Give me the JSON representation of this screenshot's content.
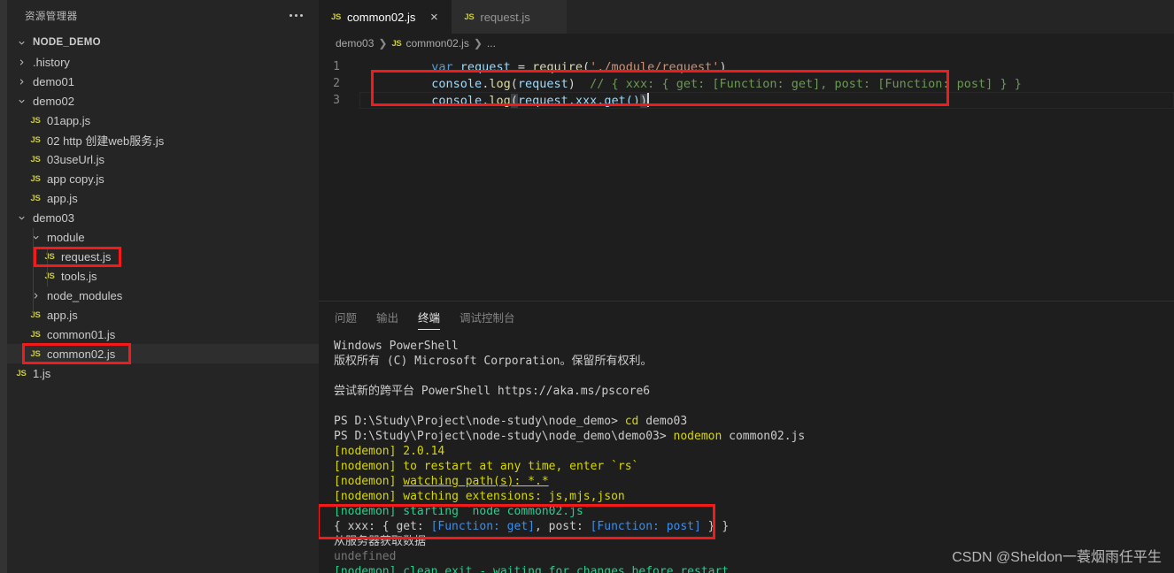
{
  "sidebar": {
    "title": "资源管理器",
    "more_icon": "ellipsis-icon",
    "root": "NODE_DEMO",
    "items": [
      {
        "label": ".history",
        "kind": "folder",
        "state": "collapsed",
        "depth": 1
      },
      {
        "label": "demo01",
        "kind": "folder",
        "state": "collapsed",
        "depth": 1
      },
      {
        "label": "demo02",
        "kind": "folder",
        "state": "expanded",
        "depth": 1
      },
      {
        "label": "01app.js",
        "kind": "file",
        "state": "",
        "depth": 2
      },
      {
        "label": "02 http 创建web服务.js",
        "kind": "file",
        "state": "",
        "depth": 2
      },
      {
        "label": "03useUrl.js",
        "kind": "file",
        "state": "",
        "depth": 2
      },
      {
        "label": "app copy.js",
        "kind": "file",
        "state": "",
        "depth": 2
      },
      {
        "label": "app.js",
        "kind": "file",
        "state": "",
        "depth": 2
      },
      {
        "label": "demo03",
        "kind": "folder",
        "state": "expanded",
        "depth": 1
      },
      {
        "label": "module",
        "kind": "folder",
        "state": "expanded",
        "depth": 2
      },
      {
        "label": "request.js",
        "kind": "file",
        "state": "",
        "depth": 3,
        "highlight": true
      },
      {
        "label": "tools.js",
        "kind": "file",
        "state": "",
        "depth": 3
      },
      {
        "label": "node_modules",
        "kind": "folder",
        "state": "collapsed",
        "depth": 2
      },
      {
        "label": "app.js",
        "kind": "file",
        "state": "",
        "depth": 2
      },
      {
        "label": "common01.js",
        "kind": "file",
        "state": "",
        "depth": 2
      },
      {
        "label": "common02.js",
        "kind": "file",
        "state": "",
        "depth": 2,
        "selected": true,
        "highlight": true
      },
      {
        "label": "1.js",
        "kind": "file",
        "state": "",
        "depth": 1
      }
    ]
  },
  "editor": {
    "tabs": [
      {
        "label": "common02.js",
        "active": true,
        "close_icon": "×"
      },
      {
        "label": "request.js",
        "active": false,
        "close_icon": "×"
      }
    ],
    "breadcrumb": [
      "demo03",
      "common02.js",
      "..."
    ],
    "lines": [
      {
        "no": "1"
      },
      {
        "no": "2"
      },
      {
        "no": "3"
      }
    ],
    "code": {
      "l1_kw": "var",
      "l1_var": " request ",
      "l1_op": "= ",
      "l1_fn": "require",
      "l1_paren_open": "(",
      "l1_str": "'./module/request'",
      "l1_paren_close": ")",
      "l2_obj": "console",
      "l2_dot": ".",
      "l2_fn": "log",
      "l2_open": "(",
      "l2_arg": "request",
      "l2_close": ")",
      "l2_comment": "  // { xxx: { get: [Function: get], post: [Function: post] } }",
      "l3_obj": "console",
      "l3_dot": ".",
      "l3_fn": "log",
      "l3_open": "(",
      "l3_arg": "request.xxx.get()",
      "l3_close": ")"
    }
  },
  "panel": {
    "tabs": [
      {
        "label": "问题",
        "active": false
      },
      {
        "label": "输出",
        "active": false
      },
      {
        "label": "终端",
        "active": true
      },
      {
        "label": "调试控制台",
        "active": false
      }
    ],
    "terminal": [
      {
        "text": "Windows PowerShell",
        "color": "t-white"
      },
      {
        "text": "版权所有 (C) Microsoft Corporation。保留所有权利。",
        "color": "t-white"
      },
      {
        "text": "",
        "color": "t-white"
      },
      {
        "text": "尝试新的跨平台 PowerShell https://aka.ms/pscore6",
        "color": "t-white"
      },
      {
        "text": "",
        "color": "t-white"
      }
    ],
    "prompt1_path": "PS D:\\Study\\Project\\node-study\\node_demo> ",
    "prompt1_cmd": "cd",
    "prompt1_arg": " demo03",
    "prompt2_path": "PS D:\\Study\\Project\\node-study\\node_demo\\demo03> ",
    "prompt2_cmd": "nodemon",
    "prompt2_arg": " common02.js",
    "nodemon_lines": [
      {
        "tag": "[nodemon] ",
        "rest": "2.0.14"
      },
      {
        "tag": "[nodemon] ",
        "rest": "to restart at any time, enter `rs`"
      },
      {
        "tag": "[nodemon] ",
        "rest": "watching path(s): *.*"
      },
      {
        "tag": "[nodemon] ",
        "rest": "watching extensions: js,mjs,json"
      },
      {
        "tag": "[nodemon] ",
        "rest": "starting `node common02.js`"
      }
    ],
    "out_pre": "{ xxx: { get: ",
    "out_fn1": "[Function: get]",
    "out_mid": ", post: ",
    "out_fn2": "[Function: post]",
    "out_post": " } }",
    "out_cn": "从服务器获取数据",
    "out_undefined": "undefined",
    "exit_tag": "[nodemon] ",
    "exit_rest": "clean exit - waiting for changes before restart"
  },
  "watermark": "CSDN @Sheldon一蓑烟雨任平生",
  "colors": {
    "accent_red": "#f41a1a",
    "editor_bg": "#1e1e1e",
    "sidebar_bg": "#252526",
    "js_icon": "#cbcb41"
  }
}
